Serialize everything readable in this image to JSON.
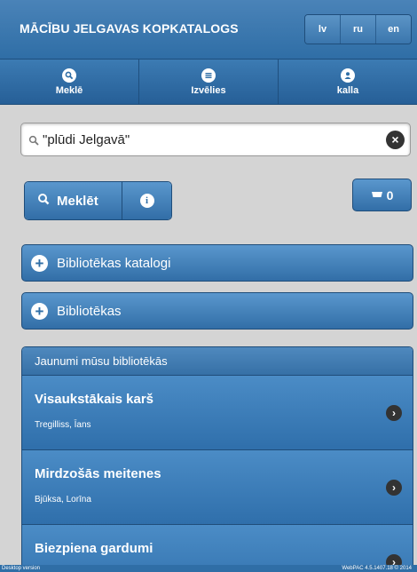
{
  "app": {
    "title": "MĀCĪBU JELGAVAS KOPKATALOGS"
  },
  "lang": {
    "lv": "lv",
    "ru": "ru",
    "en": "en"
  },
  "nav": [
    {
      "label": "Meklē",
      "icon": "search-icon"
    },
    {
      "label": "Izvēlies",
      "icon": "list-icon"
    },
    {
      "label": "kalla",
      "icon": "user-icon"
    }
  ],
  "search": {
    "value": "\"plūdi Jelgavā\""
  },
  "buttons": {
    "search_label": "Meklēt",
    "basket_count": "0"
  },
  "collapsibles": {
    "catalogs": "Bibliotēkas katalogi",
    "libraries": "Bibliotēkas"
  },
  "news": {
    "header": "Jaunumi mūsu bibliotēkās",
    "items": [
      {
        "title": "Visaukstākais karš",
        "author": "Tregilliss, Īans"
      },
      {
        "title": "Mirdzošās meitenes",
        "author": "Bjūksa, Lorīna"
      },
      {
        "title": "Biezpiena gardumi",
        "author": ""
      }
    ]
  },
  "footer": {
    "left": "Desktop version",
    "right": "WebPAC 4.5.1407.18 © 2014"
  },
  "colors": {
    "accent": "#2f6ea6",
    "background": "#d4d4d4"
  }
}
